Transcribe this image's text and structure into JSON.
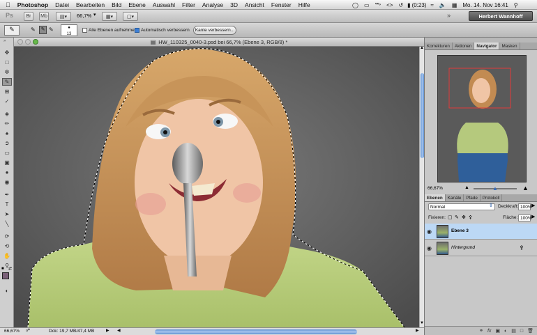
{
  "menubar": {
    "apple": "",
    "app_name": "Photoshop",
    "items": [
      "Datei",
      "Bearbeiten",
      "Bild",
      "Ebene",
      "Auswahl",
      "Filter",
      "Analyse",
      "3D",
      "Ansicht",
      "Fenster",
      "Hilfe"
    ],
    "battery": "(0:23)",
    "clock": "Mo. 14. Nov  16:41"
  },
  "appbar": {
    "ps_logo": "Ps",
    "zoom": "66,7%",
    "user": "Herbert Wannhoff"
  },
  "options": {
    "brush_size": "13",
    "sample_all_layers": "Alle Ebenen aufnehmen",
    "sample_all_checked": false,
    "auto_enhance": "Automatisch verbessern",
    "auto_enhance_checked": true,
    "refine_edge_button": "Kante verbessern..."
  },
  "document": {
    "title": "HW_110325_0040-3.psd bei 66,7% (Ebene 3, RGB/8) *"
  },
  "status": {
    "zoom": "66,67%",
    "doc_info": "Dok: 19,7 MB/47,4 MB"
  },
  "panels": {
    "top_tabs": [
      "Korrekturen",
      "Aktionen",
      "Navigator",
      "Masken"
    ],
    "nav_zoom": "66,67%",
    "layer_tabs": [
      "Ebenen",
      "Kanäle",
      "Pfade",
      "Protokoll"
    ],
    "blend_mode": "Normal",
    "opacity_label": "Deckkraft:",
    "opacity": "100%",
    "lock_label": "Fixieren:",
    "fill_label": "Fläche:",
    "fill": "100%",
    "layers": [
      {
        "name": "Ebene 3",
        "selected": true
      },
      {
        "name": "Hintergrund",
        "selected": false
      }
    ]
  },
  "colors": {
    "selection_blue": "#bcd8f5",
    "foreground": "#101010",
    "background": "#7a6078"
  }
}
